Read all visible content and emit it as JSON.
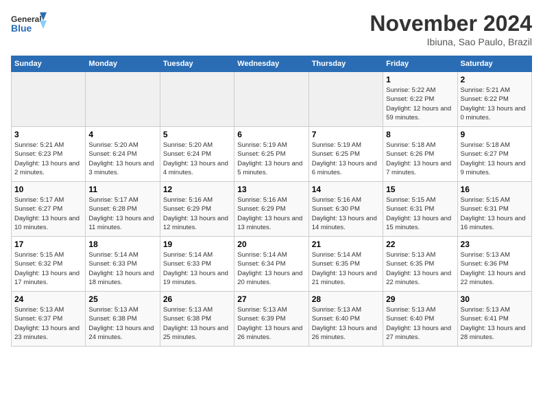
{
  "logo": {
    "text_general": "General",
    "text_blue": "Blue"
  },
  "header": {
    "month_title": "November 2024",
    "location": "Ibiuna, Sao Paulo, Brazil"
  },
  "weekdays": [
    "Sunday",
    "Monday",
    "Tuesday",
    "Wednesday",
    "Thursday",
    "Friday",
    "Saturday"
  ],
  "weeks": [
    {
      "days": [
        {
          "num": "",
          "info": ""
        },
        {
          "num": "",
          "info": ""
        },
        {
          "num": "",
          "info": ""
        },
        {
          "num": "",
          "info": ""
        },
        {
          "num": "",
          "info": ""
        },
        {
          "num": "1",
          "info": "Sunrise: 5:22 AM\nSunset: 6:22 PM\nDaylight: 12 hours and 59 minutes."
        },
        {
          "num": "2",
          "info": "Sunrise: 5:21 AM\nSunset: 6:22 PM\nDaylight: 13 hours and 0 minutes."
        }
      ]
    },
    {
      "days": [
        {
          "num": "3",
          "info": "Sunrise: 5:21 AM\nSunset: 6:23 PM\nDaylight: 13 hours and 2 minutes."
        },
        {
          "num": "4",
          "info": "Sunrise: 5:20 AM\nSunset: 6:24 PM\nDaylight: 13 hours and 3 minutes."
        },
        {
          "num": "5",
          "info": "Sunrise: 5:20 AM\nSunset: 6:24 PM\nDaylight: 13 hours and 4 minutes."
        },
        {
          "num": "6",
          "info": "Sunrise: 5:19 AM\nSunset: 6:25 PM\nDaylight: 13 hours and 5 minutes."
        },
        {
          "num": "7",
          "info": "Sunrise: 5:19 AM\nSunset: 6:25 PM\nDaylight: 13 hours and 6 minutes."
        },
        {
          "num": "8",
          "info": "Sunrise: 5:18 AM\nSunset: 6:26 PM\nDaylight: 13 hours and 7 minutes."
        },
        {
          "num": "9",
          "info": "Sunrise: 5:18 AM\nSunset: 6:27 PM\nDaylight: 13 hours and 9 minutes."
        }
      ]
    },
    {
      "days": [
        {
          "num": "10",
          "info": "Sunrise: 5:17 AM\nSunset: 6:27 PM\nDaylight: 13 hours and 10 minutes."
        },
        {
          "num": "11",
          "info": "Sunrise: 5:17 AM\nSunset: 6:28 PM\nDaylight: 13 hours and 11 minutes."
        },
        {
          "num": "12",
          "info": "Sunrise: 5:16 AM\nSunset: 6:29 PM\nDaylight: 13 hours and 12 minutes."
        },
        {
          "num": "13",
          "info": "Sunrise: 5:16 AM\nSunset: 6:29 PM\nDaylight: 13 hours and 13 minutes."
        },
        {
          "num": "14",
          "info": "Sunrise: 5:16 AM\nSunset: 6:30 PM\nDaylight: 13 hours and 14 minutes."
        },
        {
          "num": "15",
          "info": "Sunrise: 5:15 AM\nSunset: 6:31 PM\nDaylight: 13 hours and 15 minutes."
        },
        {
          "num": "16",
          "info": "Sunrise: 5:15 AM\nSunset: 6:31 PM\nDaylight: 13 hours and 16 minutes."
        }
      ]
    },
    {
      "days": [
        {
          "num": "17",
          "info": "Sunrise: 5:15 AM\nSunset: 6:32 PM\nDaylight: 13 hours and 17 minutes."
        },
        {
          "num": "18",
          "info": "Sunrise: 5:14 AM\nSunset: 6:33 PM\nDaylight: 13 hours and 18 minutes."
        },
        {
          "num": "19",
          "info": "Sunrise: 5:14 AM\nSunset: 6:33 PM\nDaylight: 13 hours and 19 minutes."
        },
        {
          "num": "20",
          "info": "Sunrise: 5:14 AM\nSunset: 6:34 PM\nDaylight: 13 hours and 20 minutes."
        },
        {
          "num": "21",
          "info": "Sunrise: 5:14 AM\nSunset: 6:35 PM\nDaylight: 13 hours and 21 minutes."
        },
        {
          "num": "22",
          "info": "Sunrise: 5:13 AM\nSunset: 6:35 PM\nDaylight: 13 hours and 22 minutes."
        },
        {
          "num": "23",
          "info": "Sunrise: 5:13 AM\nSunset: 6:36 PM\nDaylight: 13 hours and 22 minutes."
        }
      ]
    },
    {
      "days": [
        {
          "num": "24",
          "info": "Sunrise: 5:13 AM\nSunset: 6:37 PM\nDaylight: 13 hours and 23 minutes."
        },
        {
          "num": "25",
          "info": "Sunrise: 5:13 AM\nSunset: 6:38 PM\nDaylight: 13 hours and 24 minutes."
        },
        {
          "num": "26",
          "info": "Sunrise: 5:13 AM\nSunset: 6:38 PM\nDaylight: 13 hours and 25 minutes."
        },
        {
          "num": "27",
          "info": "Sunrise: 5:13 AM\nSunset: 6:39 PM\nDaylight: 13 hours and 26 minutes."
        },
        {
          "num": "28",
          "info": "Sunrise: 5:13 AM\nSunset: 6:40 PM\nDaylight: 13 hours and 26 minutes."
        },
        {
          "num": "29",
          "info": "Sunrise: 5:13 AM\nSunset: 6:40 PM\nDaylight: 13 hours and 27 minutes."
        },
        {
          "num": "30",
          "info": "Sunrise: 5:13 AM\nSunset: 6:41 PM\nDaylight: 13 hours and 28 minutes."
        }
      ]
    }
  ]
}
